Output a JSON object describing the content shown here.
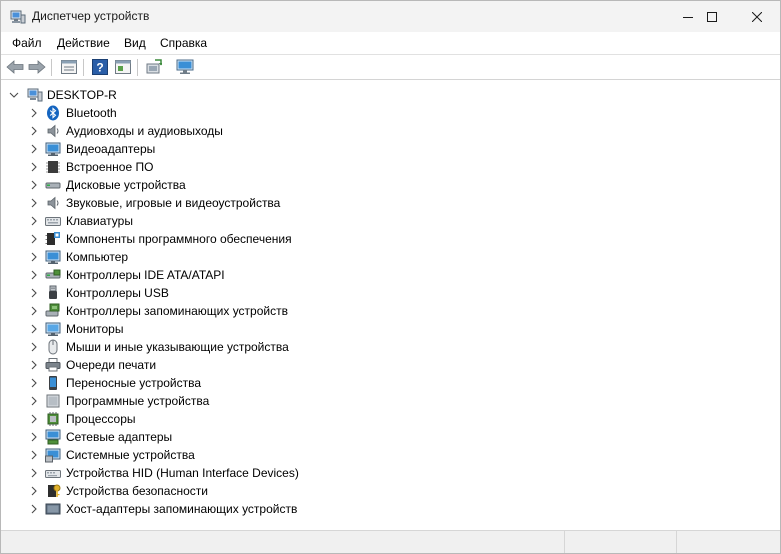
{
  "window": {
    "title": "Диспетчер устройств",
    "title_icon": "device-manager-icon"
  },
  "window_controls": {
    "minimize_icon": "minimize-icon",
    "maximize_icon": "maximize-icon",
    "close_icon": "close-icon"
  },
  "menu": {
    "file": "Файл",
    "action": "Действие",
    "view": "Вид",
    "help": "Справка"
  },
  "toolbar": {
    "buttons": [
      "back-arrow-icon",
      "forward-arrow-icon",
      "properties-icon",
      "help-icon",
      "show-hidden-icon",
      "scan-hardware-icon",
      "monitor-icon"
    ]
  },
  "tree": {
    "root": {
      "label": "DESKTOP-R",
      "icon": "computer-root-icon",
      "expanded": true
    },
    "categories": [
      {
        "label": "Bluetooth",
        "icon": "bluetooth-icon"
      },
      {
        "label": "Аудиовходы и аудиовыходы",
        "icon": "speaker-icon"
      },
      {
        "label": "Видеоадаптеры",
        "icon": "display-adapter-icon"
      },
      {
        "label": "Встроенное ПО",
        "icon": "firmware-chip-icon"
      },
      {
        "label": "Дисковые устройства",
        "icon": "disk-drive-icon"
      },
      {
        "label": "Звуковые, игровые и видеоустройства",
        "icon": "sound-icon"
      },
      {
        "label": "Клавиатуры",
        "icon": "keyboard-icon"
      },
      {
        "label": "Компоненты программного обеспечения",
        "icon": "software-component-icon"
      },
      {
        "label": "Компьютер",
        "icon": "computer-icon"
      },
      {
        "label": "Контроллеры IDE ATA/ATAPI",
        "icon": "ide-controller-icon"
      },
      {
        "label": "Контроллеры USB",
        "icon": "usb-icon"
      },
      {
        "label": "Контроллеры запоминающих устройств",
        "icon": "storage-controller-icon"
      },
      {
        "label": "Мониторы",
        "icon": "monitor-icon"
      },
      {
        "label": "Мыши и иные указывающие устройства",
        "icon": "mouse-icon"
      },
      {
        "label": "Очереди печати",
        "icon": "printer-icon"
      },
      {
        "label": "Переносные устройства",
        "icon": "portable-device-icon"
      },
      {
        "label": "Программные устройства",
        "icon": "software-device-icon"
      },
      {
        "label": "Процессоры",
        "icon": "processor-icon"
      },
      {
        "label": "Сетевые адаптеры",
        "icon": "network-adapter-icon"
      },
      {
        "label": "Системные устройства",
        "icon": "system-devices-icon"
      },
      {
        "label": "Устройства HID (Human Interface Devices)",
        "icon": "hid-icon"
      },
      {
        "label": "Устройства безопасности",
        "icon": "security-device-icon"
      },
      {
        "label": "Хост-адаптеры запоминающих устройств",
        "icon": "storage-host-adapter-icon"
      }
    ]
  },
  "colors": {
    "titlebar_bg": "#f3f3f3",
    "bluetooth": "#1565c0",
    "monitor_screen": "#3a8fd6",
    "chip_green": "#4f8f3a"
  }
}
